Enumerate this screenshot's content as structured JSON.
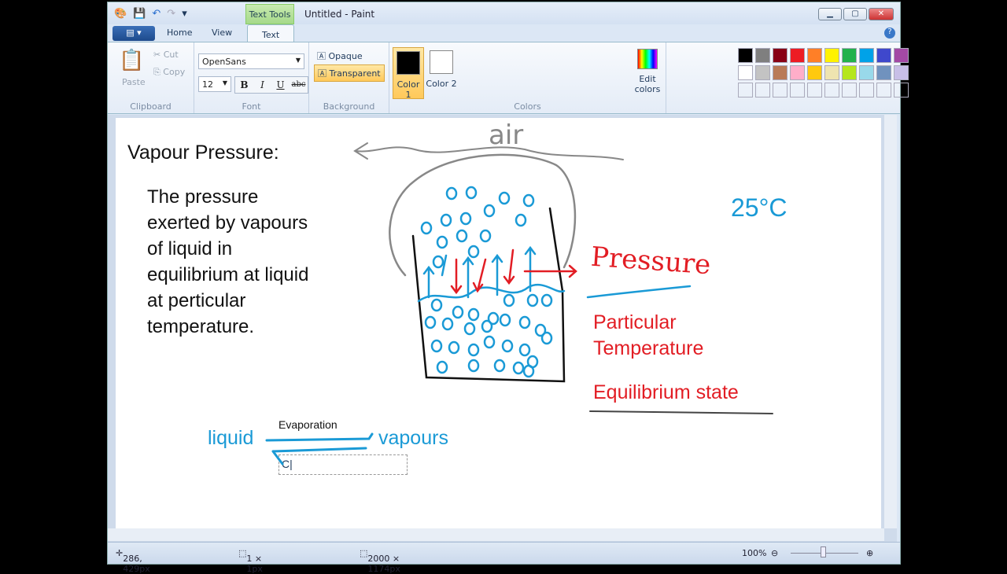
{
  "window": {
    "title": "Untitled - Paint",
    "context_tab": "Text Tools"
  },
  "tabs": [
    "Home",
    "View",
    "Text"
  ],
  "clipboard": {
    "paste": "Paste",
    "cut": "Cut",
    "copy": "Copy",
    "label": "Clipboard"
  },
  "font": {
    "family": "OpenSans",
    "size": "12",
    "bold": "B",
    "italic": "I",
    "underline": "U",
    "strike": "abc",
    "label": "Font"
  },
  "background": {
    "opaque": "Opaque",
    "transparent": "Transparent",
    "label": "Background"
  },
  "colors": {
    "color1": "Color 1",
    "color2": "Color 2",
    "edit": "Edit colors",
    "label": "Colors",
    "color1_value": "#000000",
    "color2_value": "#ffffff",
    "palette": [
      "#000000",
      "#7f7f7f",
      "#880015",
      "#ed1c24",
      "#ff7f27",
      "#fff200",
      "#22b14c",
      "#00a2e8",
      "#3f48cc",
      "#a349a4",
      "#ffffff",
      "#c3c3c3",
      "#b97a57",
      "#ffaec9",
      "#ffc90e",
      "#efe4b0",
      "#b5e61d",
      "#99d9ea",
      "#7092be",
      "#c8bfe7"
    ]
  },
  "canvas": {
    "heading": "Vapour Pressure:",
    "definition": [
      "The pressure",
      "exerted by vapours",
      "of liquid in",
      "equilibrium at liquid",
      "at perticular",
      "temperature."
    ],
    "air": "air",
    "temp": "25°C",
    "pressure": "Pressure",
    "particular": [
      "Particular",
      "Temperature"
    ],
    "equilibrium": "Equilibrium state",
    "liquid": "liquid",
    "vapours": "vapours",
    "evaporation": "Evaporation",
    "typing": "C"
  },
  "status": {
    "cursor": "286, 429px",
    "selection": "1 × 1px",
    "size": "2000 × 1174px",
    "zoom": "100%"
  }
}
